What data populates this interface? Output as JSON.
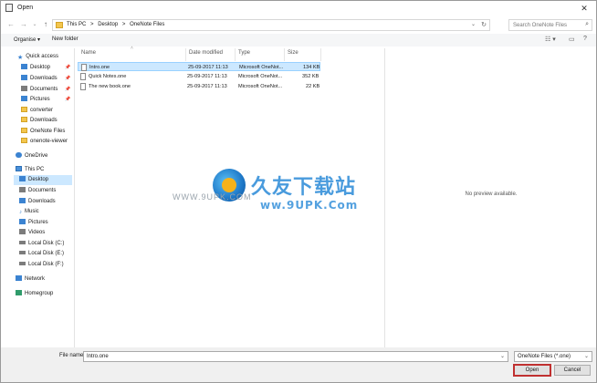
{
  "window": {
    "title": "Open"
  },
  "address": {
    "crumbs": [
      "This PC",
      ">",
      "Desktop",
      ">",
      "OneNote Files"
    ],
    "search_placeholder": "Search OneNote Files"
  },
  "toolbar": {
    "organise": "Organise ▾",
    "new_folder": "New folder"
  },
  "tree": {
    "quick_access": "Quick access",
    "desktop": "Desktop",
    "downloads": "Downloads",
    "documents": "Documents",
    "pictures": "Pictures",
    "converter": "converter",
    "downloads2": "Downloads",
    "onenote_files": "OneNote Files",
    "onenote_viewer": "onenote-viewer",
    "onedrive": "OneDrive",
    "this_pc": "This PC",
    "pc_desktop": "Desktop",
    "pc_documents": "Documents",
    "pc_downloads": "Downloads",
    "music": "Music",
    "pc_pictures": "Pictures",
    "videos": "Videos",
    "disk_c": "Local Disk (C:)",
    "disk_e": "Local Disk (E:)",
    "disk_f": "Local Disk (F:)",
    "network": "Network",
    "homegroup": "Homegroup"
  },
  "columns": {
    "name": "Name",
    "date": "Date modified",
    "type": "Type",
    "size": "Size"
  },
  "files": [
    {
      "name": "Intro.one",
      "date": "25-09-2017 11:13",
      "type": "Microsoft OneNot...",
      "size": "134 KB"
    },
    {
      "name": "Quick Notes.one",
      "date": "25-09-2017 11:13",
      "type": "Microsoft OneNot...",
      "size": "352 KB"
    },
    {
      "name": "The new book.one",
      "date": "25-09-2017 11:13",
      "type": "Microsoft OneNot...",
      "size": "22 KB"
    }
  ],
  "preview": {
    "text": "No preview available."
  },
  "watermark": {
    "cn": "久友下载站",
    "url_left": "WWW.9UPK.COM",
    "url_right": "ww.9UPK.Com"
  },
  "bottom": {
    "file_name_label": "File name:",
    "file_name_value": "Intro.one",
    "file_type": "OneNote Files (*.one)",
    "open": "Open",
    "cancel": "Cancel"
  },
  "colors": {
    "selection": "#cce8ff",
    "accent": "#2a8ad8",
    "folder": "#f3c64d"
  }
}
